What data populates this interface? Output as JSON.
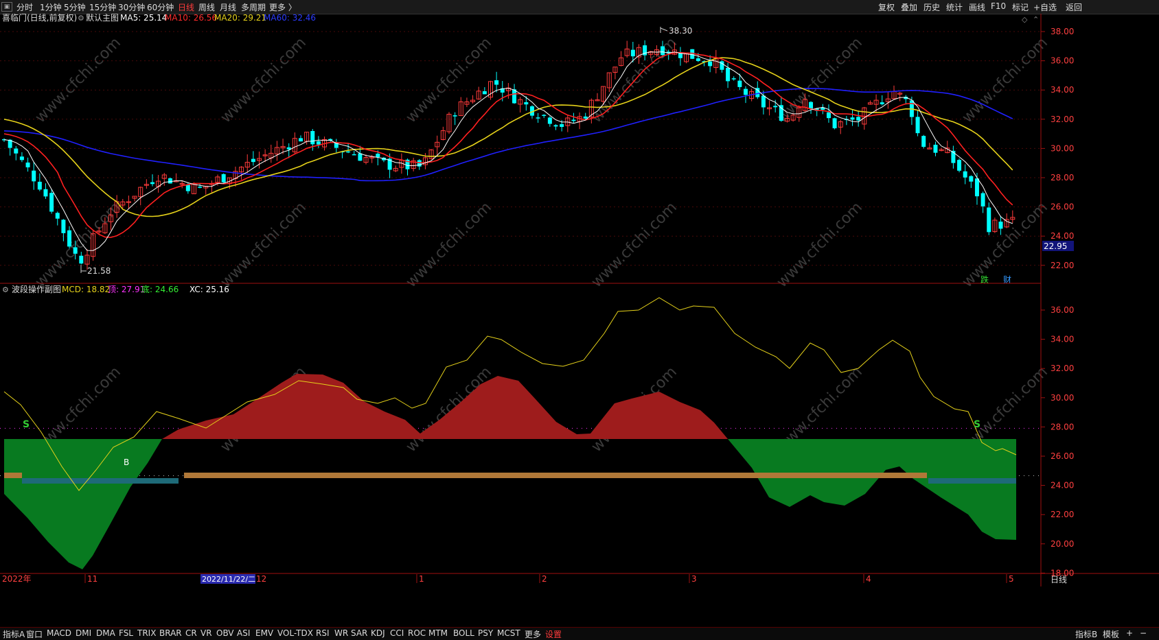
{
  "topbar": {
    "periods": [
      "分时",
      "1分钟",
      "5分钟",
      "15分钟",
      "30分钟",
      "60分钟",
      "日线",
      "周线",
      "月线",
      "多周期",
      "更多 〉"
    ],
    "active_period": "日线",
    "right_buttons": [
      "复权",
      "叠加",
      "历史",
      "统计",
      "画线",
      "F10",
      "标记",
      "+自选",
      "返回"
    ]
  },
  "main_panel": {
    "stock_title": "喜临门(日线,前复权)",
    "template": "默认主图",
    "ma_labels": [
      {
        "text": "MA5: 25.14",
        "color": "#ffffff"
      },
      {
        "text": "MA10: 26.56",
        "color": "#ff2b2b"
      },
      {
        "text": "MA20: 29.21",
        "color": "#e6d21a"
      },
      {
        "text": "MA60: 32.46",
        "color": "#2b3bff"
      }
    ],
    "price_ticks": [
      "38.00",
      "36.00",
      "34.00",
      "32.00",
      "30.00",
      "28.00",
      "26.00",
      "24.00",
      "22.00"
    ],
    "current_price": "22.95",
    "high_marker": "38.30",
    "low_marker": "21.58",
    "event_badges": [
      {
        "text": "跌",
        "color": "#33dd33"
      },
      {
        "text": "财",
        "color": "#3399ff"
      }
    ]
  },
  "sub_panel": {
    "title": "波段操作副图",
    "labels": [
      {
        "text": "MCD: 18.82",
        "color": "#e6d21a"
      },
      {
        "text": "顶: 27.91",
        "color": "#ff33ff"
      },
      {
        "text": "底: 24.66",
        "color": "#33ee33"
      },
      {
        "text": "XC: 25.16",
        "color": "#ffffff"
      }
    ],
    "ticks": [
      "36.00",
      "34.00",
      "32.00",
      "30.00",
      "28.00",
      "26.00",
      "24.00",
      "22.00",
      "20.00",
      "18.00"
    ],
    "signals": [
      {
        "text": "S",
        "color": "#33cc33"
      },
      {
        "text": "B",
        "color": "#ffffff"
      },
      {
        "text": "S",
        "color": "#33cc33"
      }
    ]
  },
  "time_axis": {
    "labels": [
      "2022年",
      "11",
      "12",
      "1",
      "2",
      "3",
      "4",
      "5"
    ],
    "cursor_date": "2022/11/22/二",
    "period_label": "日线"
  },
  "bottombar": {
    "items": [
      "指标A",
      "窗口",
      "MACD",
      "DMI",
      "DMA",
      "FSL",
      "TRIX",
      "BRAR",
      "CR",
      "VR",
      "OBV",
      "ASI",
      "EMV",
      "VOL-TDX",
      "RSI",
      "WR",
      "SAR",
      "KDJ",
      "CCI",
      "ROC",
      "MTM",
      "BOLL",
      "PSY",
      "MCST",
      "更多"
    ],
    "settings_label": "设置",
    "right_items": [
      "指标B",
      "模板",
      "+",
      "−"
    ]
  },
  "watermark": "www.cfchi.com",
  "colors": {
    "up": "#ff3b3b",
    "down": "#00ffff",
    "ma5": "#ffffff",
    "ma10": "#ff2020",
    "ma20": "#e6d21a",
    "ma60": "#2020ff",
    "red_area": "#9e1c1c",
    "green_area": "#087a20",
    "axis": "#a01010",
    "mcd_line": "#e6d21a",
    "brown_band": "#b07838",
    "teal_band": "#1e6a78"
  }
}
